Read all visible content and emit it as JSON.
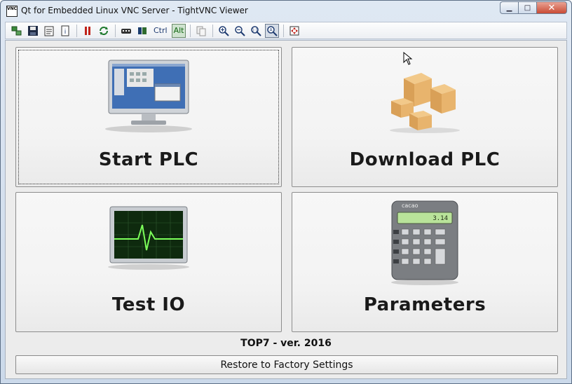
{
  "window": {
    "title": "Qt for Embedded Linux VNC Server - TightVNC Viewer",
    "app_icon_text": "VNC",
    "controls": {
      "minimize": "▁",
      "maximize": "□",
      "close": "✕"
    }
  },
  "toolbar": {
    "ctrl_label": "Ctrl",
    "alt_label": "Alt",
    "icons": [
      "new-connection-icon",
      "save-icon",
      "options-icon",
      "connection-info-icon",
      "pause-icon",
      "refresh-icon",
      "ctrl-alt-del-icon",
      "ctrl-esc-icon",
      "ctrl-key-icon",
      "alt-key-icon",
      "copy-icon",
      "zoom-in-icon",
      "zoom-out-icon",
      "zoom-100-icon",
      "zoom-auto-icon",
      "fullscreen-icon"
    ]
  },
  "tiles": {
    "start_plc": "Start PLC",
    "download_plc": "Download PLC",
    "test_io": "Test IO",
    "parameters": "Parameters"
  },
  "calculator": {
    "brand": "cacao",
    "display": "3.14"
  },
  "footer": {
    "version": "TOP7 - ver. 2016",
    "factory_button": "Restore to Factory Settings"
  }
}
